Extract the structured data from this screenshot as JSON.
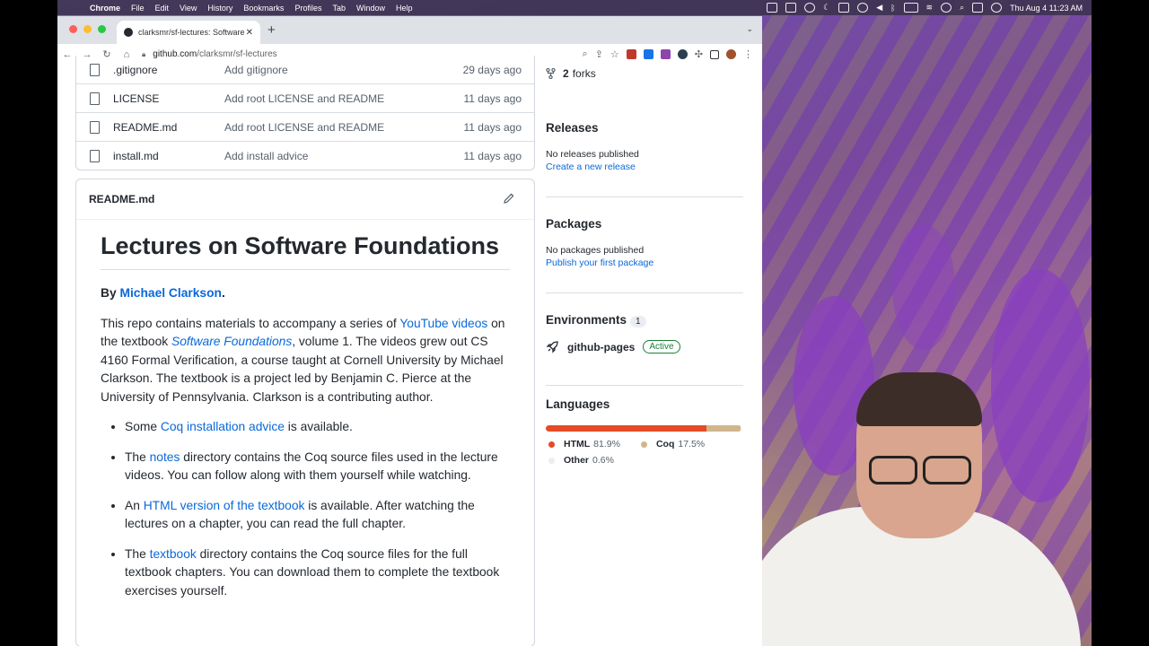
{
  "menubar": {
    "items": [
      "Chrome",
      "File",
      "Edit",
      "View",
      "History",
      "Bookmarks",
      "Profiles",
      "Tab",
      "Window",
      "Help"
    ],
    "clock": "Thu Aug 4  11:23 AM"
  },
  "browser": {
    "tab_title": "clarksmr/sf-lectures: Software",
    "url_host": "github.com",
    "url_path": "/clarksmr/sf-lectures"
  },
  "files": [
    {
      "name": ".gitignore",
      "message": "Add gitignore",
      "age": "29 days ago"
    },
    {
      "name": "LICENSE",
      "message": "Add root LICENSE and README",
      "age": "11 days ago"
    },
    {
      "name": "README.md",
      "message": "Add root LICENSE and README",
      "age": "11 days ago"
    },
    {
      "name": "install.md",
      "message": "Add install advice",
      "age": "11 days ago"
    }
  ],
  "readme": {
    "header": "README.md",
    "title": "Lectures on Software Foundations",
    "by_prefix": "By ",
    "author": "Michael Clarkson",
    "by_suffix": ".",
    "intro": {
      "p1": "This repo contains materials to accompany a series of ",
      "link1": "YouTube videos",
      "p2": " on the textbook ",
      "link2": "Software Foundations",
      "p3": ", volume 1. The videos grew out CS 4160 Formal Verification, a course taught at Cornell University by Michael Clarkson. The textbook is a project led by Benjamin C. Pierce at the University of Pennsylvania. Clarkson is a contributing author."
    },
    "bullets": [
      {
        "pre": "Some ",
        "link": "Coq installation advice",
        "post": " is available."
      },
      {
        "pre": "The ",
        "link": "notes",
        "post": " directory contains the Coq source files used in the lecture videos. You can follow along with them yourself while watching."
      },
      {
        "pre": "An ",
        "link": "HTML version of the textbook",
        "post": " is available. After watching the lectures on a chapter, you can read the full chapter."
      },
      {
        "pre": "The ",
        "link": "textbook",
        "post": " directory contains the Coq source files for the full textbook chapters. You can download them to complete the textbook exercises yourself."
      }
    ]
  },
  "sidebar": {
    "forks_count": "2",
    "forks_label": "forks",
    "releases": {
      "title": "Releases",
      "empty": "No releases published",
      "link": "Create a new release"
    },
    "packages": {
      "title": "Packages",
      "empty": "No packages published",
      "link": "Publish your first package"
    },
    "environments": {
      "title": "Environments",
      "count": "1",
      "name": "github-pages",
      "status": "Active"
    },
    "languages": {
      "title": "Languages",
      "items": [
        {
          "name": "HTML",
          "percent": "81.9%",
          "value": 81.9,
          "color": "#e34c26"
        },
        {
          "name": "Coq",
          "percent": "17.5%",
          "value": 17.5,
          "color": "#d0b68c"
        },
        {
          "name": "Other",
          "percent": "0.6%",
          "value": 0.6,
          "color": "#ededed"
        }
      ]
    }
  }
}
